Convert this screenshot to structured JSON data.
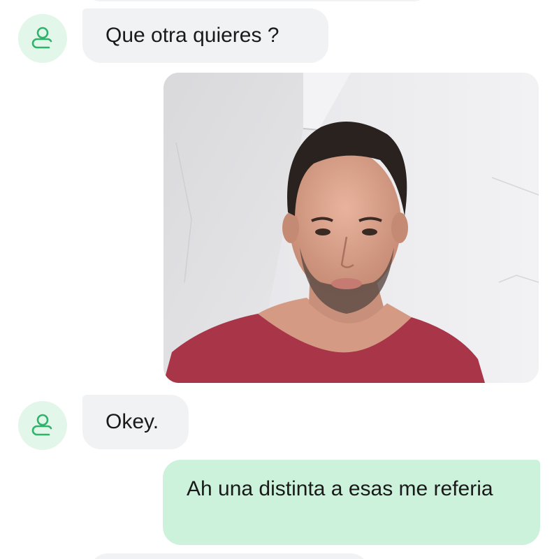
{
  "conversation": {
    "messages": [
      {
        "direction": "incoming",
        "type": "text",
        "text": "Que otra quieres ?"
      },
      {
        "direction": "outgoing",
        "type": "photo"
      },
      {
        "direction": "incoming",
        "type": "text",
        "text": "Okey."
      },
      {
        "direction": "outgoing",
        "type": "text",
        "text": "Ah una distinta a esas me referia"
      }
    ]
  },
  "icons": {
    "contact_avatar": "person-outline-icon"
  },
  "colors": {
    "incoming_bubble": "#f1f2f4",
    "outgoing_bubble": "#ccf2dc",
    "avatar_background": "#e3f6ea",
    "avatar_icon": "#2fb36b",
    "text": "#1a1a1a"
  }
}
